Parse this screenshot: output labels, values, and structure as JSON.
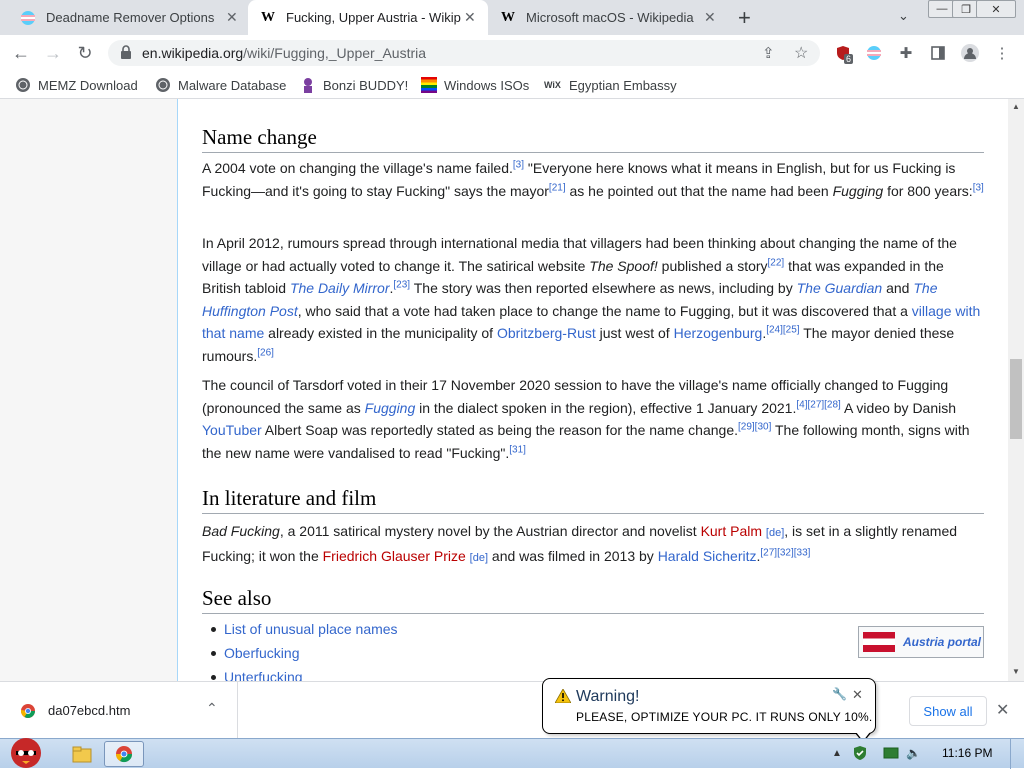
{
  "tabs": [
    {
      "title": "Deadname Remover Options",
      "favicon": "trans-flag-icon",
      "active": false
    },
    {
      "title": "Fucking, Upper Austria - Wikip",
      "favicon": "W",
      "active": true
    },
    {
      "title": "Microsoft macOS - Wikipedia",
      "favicon": "W",
      "active": false
    }
  ],
  "window_controls": {
    "minimize": "—",
    "restore": "❐",
    "close": "✕"
  },
  "address": {
    "host": "en.wikipedia.org",
    "path": "/wiki/Fugging,_Upper_Austria"
  },
  "extension_badge": "6",
  "bookmarks": [
    {
      "label": "MEMZ Download",
      "icon": "globe-icon"
    },
    {
      "label": "Malware Database",
      "icon": "globe-icon"
    },
    {
      "label": "Bonzi BUDDY!",
      "icon": "bonzi-icon"
    },
    {
      "label": "Windows ISOs",
      "icon": "rainbow-flag-icon"
    },
    {
      "label": "Egyptian Embassy",
      "icon": "wix-icon"
    }
  ],
  "article": {
    "name_change": {
      "heading": "Name change",
      "p1": {
        "a": "A 2004 vote on changing the village's name failed.",
        "r1": "[3]",
        "b": " \"Everyone here knows what it means in English, but for us Fucking is Fucking—and it's going to stay Fucking\" says the mayor",
        "r2": "[21]",
        "c": " as he pointed out that the name had been ",
        "italic": "Fugging",
        "d": " for 800 years:",
        "r3": "[3]"
      },
      "p2": {
        "a": "In April 2012, rumours spread through international media that villagers had been thinking about changing the name of the village or had actually voted to change it. The satirical website ",
        "spoof": "The Spoof!",
        "b": " published a story",
        "r1": "[22]",
        "c": " that was expanded in the British tabloid ",
        "daily_mirror": "The Daily Mirror",
        "d": ".",
        "r2": "[23]",
        "e": " The story was then reported elsewhere as news, including by ",
        "guardian": "The Guardian",
        "f": " and ",
        "huffpost": "The Huffington Post",
        "g": ", who said that a vote had taken place to change the name to Fugging, but it was discovered that a ",
        "village_link": "village with that name",
        "h": " already existed in the municipality of ",
        "obritzberg": "Obritzberg-Rust",
        "i": " just west of ",
        "herzogenburg": "Herzogenburg",
        "j": ".",
        "r3": "[24][25]",
        "k": " The mayor denied these rumours.",
        "r4": "[26]"
      },
      "p3": {
        "a": "The council of Tarsdorf voted in their 17 November 2020 session to have the village's name officially changed to Fugging (pronounced the same as ",
        "fugging": "Fugging",
        "b": " in the dialect spoken in the region), effective 1 January 2021.",
        "r1": "[4][27][28]",
        "c": " A video by Danish ",
        "youtuber": "YouTuber",
        "d": " Albert Soap was reportedly stated as being the reason for the name change.",
        "r2": "[29][30]",
        "e": " The following month, signs with the new name were vandalised to read \"Fucking\".",
        "r3": "[31]"
      }
    },
    "literature": {
      "heading": "In literature and film",
      "title_italic": "Bad Fucking",
      "a": ", a 2011 satirical mystery novel by the Austrian director and novelist ",
      "kurt_palm": "Kurt Palm",
      "de1": "[de]",
      "b": ", is set in a slightly renamed Fucking; it won the ",
      "prize": "Friedrich Glauser Prize",
      "de2": "[de]",
      "c": " and was filmed in 2013 by ",
      "harald": "Harald Sicheritz",
      "d": ".",
      "r1": "[27][32][33]"
    },
    "see_also": {
      "heading": "See also",
      "items": [
        "List of unusual place names",
        "Oberfucking",
        "Unterfucking"
      ],
      "portal": "Austria portal"
    }
  },
  "download": {
    "filename": "da07ebcd.htm",
    "show_all": "Show all"
  },
  "balloon": {
    "title": "Warning!",
    "message": "PLEASE, OPTIMIZE YOUR PC. IT RUNS ONLY 10%."
  },
  "taskbar": {
    "clock": "11:16 PM"
  }
}
